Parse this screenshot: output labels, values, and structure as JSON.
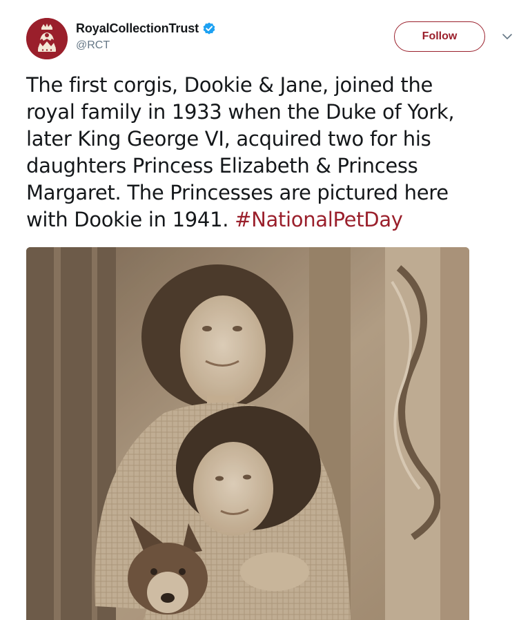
{
  "author": {
    "display_name": "RoyalCollectionTrust",
    "handle": "@RCT",
    "verified": true,
    "avatar_icon": "royal-crest-icon",
    "brand_color": "#9a1f2b"
  },
  "actions": {
    "follow_label": "Follow",
    "more_icon": "chevron-down-icon"
  },
  "tweet": {
    "lines": [
      "The first corgis, Dookie & Jane, joined the",
      "royal family in 1933 when the Duke of York,",
      "later King George VI, acquired two for his",
      "daughters Princess Elizabeth & Princess",
      "Margaret. The Princesses are pictured here",
      "with Dookie in 1941. "
    ],
    "hashtag": "#NationalPetDay"
  },
  "media": {
    "type": "sepia-photograph"
  }
}
